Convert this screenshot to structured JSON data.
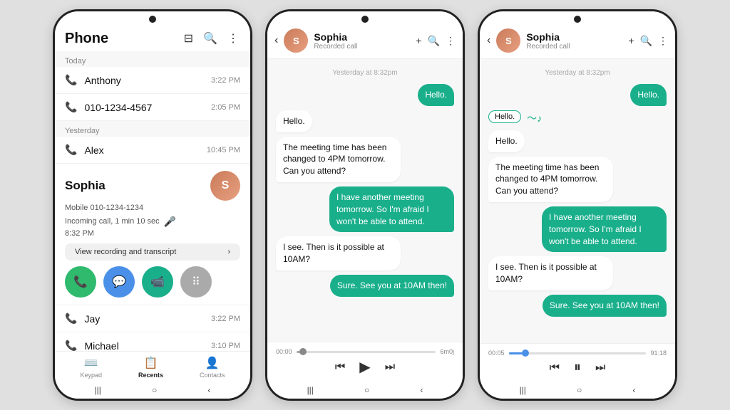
{
  "phone1": {
    "title": "Phone",
    "section_today": "Today",
    "section_yesterday": "Yesterday",
    "calls": [
      {
        "name": "Anthony",
        "time": "3:22 PM"
      },
      {
        "name": "010-1234-4567",
        "time": "2:05 PM"
      }
    ],
    "yesterday_calls": [
      {
        "name": "Alex",
        "time": "10:45 PM"
      }
    ],
    "sophia": {
      "name": "Sophia",
      "mobile": "Mobile 010-1234-1234",
      "detail": "Incoming call, 1 min 10 sec",
      "time2": "8:32 PM",
      "view_recording": "View recording and transcript"
    },
    "bottom_calls": [
      {
        "name": "Jay",
        "time": "3:22 PM"
      },
      {
        "name": "Michael",
        "time": "3:10 PM"
      }
    ],
    "nav": [
      {
        "label": "Keypad",
        "active": false
      },
      {
        "label": "Recents",
        "active": true
      },
      {
        "label": "Contacts",
        "active": false
      }
    ]
  },
  "phone2": {
    "header": {
      "name": "Sophia",
      "subtitle": "Recorded call"
    },
    "timestamp": "Yesterday at 8:32pm",
    "messages": [
      {
        "type": "sent",
        "text": "Hello."
      },
      {
        "type": "received",
        "text": "Hello."
      },
      {
        "type": "received",
        "text": "The meeting time has been changed to 4PM tomorrow. Can you attend?"
      },
      {
        "type": "sent",
        "text": "I have another meeting tomorrow. So I'm afraid I won't be able to attend."
      },
      {
        "type": "received",
        "text": "I see. Then is it possible at 10AM?"
      },
      {
        "type": "sent",
        "text": "Sure. See you at 10AM then!"
      }
    ],
    "player": {
      "start": "00:00",
      "end": "6m0j",
      "progress": 5
    }
  },
  "phone3": {
    "header": {
      "name": "Sophia",
      "subtitle": "Recorded call"
    },
    "timestamp": "Yesterday at 8:32pm",
    "highlight_word": "Hello.",
    "messages": [
      {
        "type": "sent",
        "text": "Hello."
      },
      {
        "type": "received",
        "text": "Hello."
      },
      {
        "type": "received",
        "text": "The meeting time has been changed to 4PM tomorrow. Can you attend?"
      },
      {
        "type": "sent",
        "text": "I have another meeting tomorrow. So I'm afraid I won't be able to attend."
      },
      {
        "type": "received",
        "text": "I see. Then is it possible at 10AM?"
      },
      {
        "type": "sent",
        "text": "Sure. See you at 10AM then!"
      }
    ],
    "player": {
      "start": "00:05",
      "end": "91:18",
      "progress": 12
    }
  },
  "icons": {
    "phone": "📞",
    "filter": "⊟",
    "search": "🔍",
    "more": "⋮",
    "back": "‹",
    "plus": "+",
    "mic": "🎤",
    "arrow_right": "›",
    "call": "📞",
    "video": "📹",
    "dots": "⠿",
    "rewind": "⏪",
    "play": "▶",
    "forward": "⏩",
    "pause": "⏸",
    "home": "○",
    "back_gesture": "‹",
    "recents_gesture": "|||"
  }
}
